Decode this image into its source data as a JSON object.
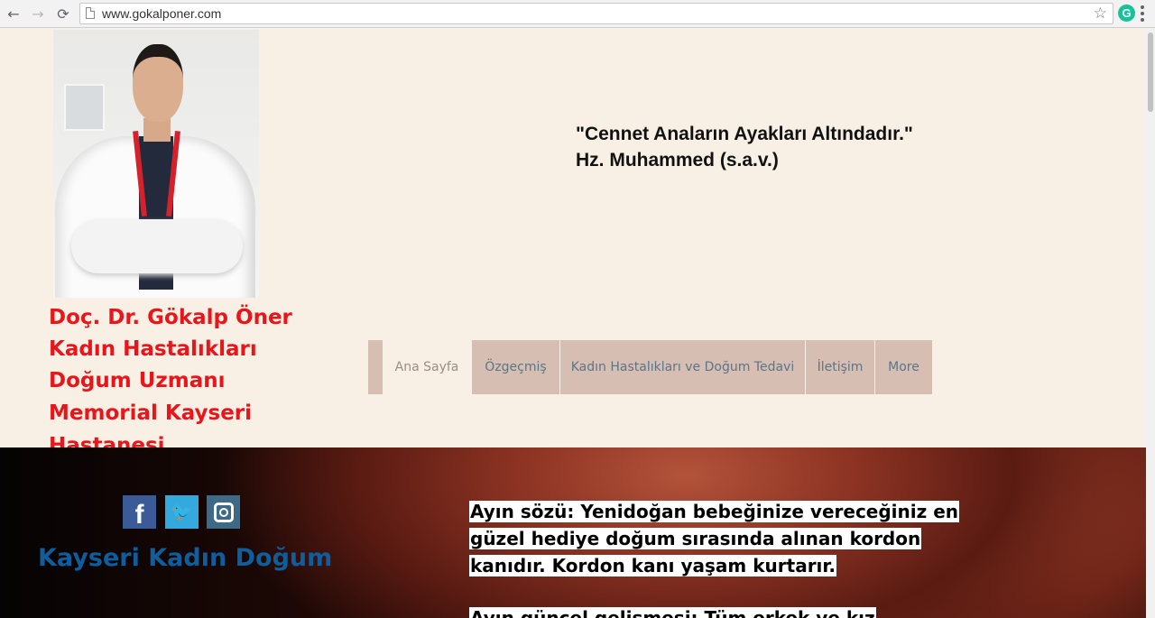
{
  "browser": {
    "url": "www.gokalponer.com",
    "back_glyph": "←",
    "forward_glyph": "→",
    "reload_glyph": "⟳",
    "star_glyph": "☆",
    "extension_letter": "G"
  },
  "header": {
    "doctor_lines": [
      "Doç. Dr. Gökalp Öner",
      "Kadın Hastalıkları",
      "Doğum Uzmanı",
      "Memorial Kayseri",
      "Hastanesi"
    ],
    "quote_line1": "\"Cennet Anaların Ayakları Altındadır.\"",
    "quote_line2": "Hz. Muhammed (s.a.v.)"
  },
  "nav": {
    "items": [
      {
        "label": "Ana Sayfa"
      },
      {
        "label": "Özgeçmiş"
      },
      {
        "label": "Kadın Hastalıkları ve Doğum Tedavi"
      },
      {
        "label": "İletişim"
      },
      {
        "label": "More"
      }
    ]
  },
  "social": {
    "facebook_glyph": "f",
    "twitter_glyph": "🐦"
  },
  "content": {
    "brand": "Kayseri Kadın Doğum",
    "month_saying_lines": [
      "Ayın sözü: Yenidoğan bebeğinize vereceğiniz en",
      "güzel hediye doğum sırasında alınan kordon",
      "kanıdır. Kordon kanı yaşam kurtarır."
    ],
    "month_news": "Ayın güncel gelişmesi: Tüm erkek ve kız"
  },
  "colors": {
    "doctor_text": "#e8161b",
    "brand_text": "#0f5d9c",
    "nav_bg": "#d6beb3",
    "nav_text": "#5c7587",
    "page_bg": "#f8efe5"
  }
}
